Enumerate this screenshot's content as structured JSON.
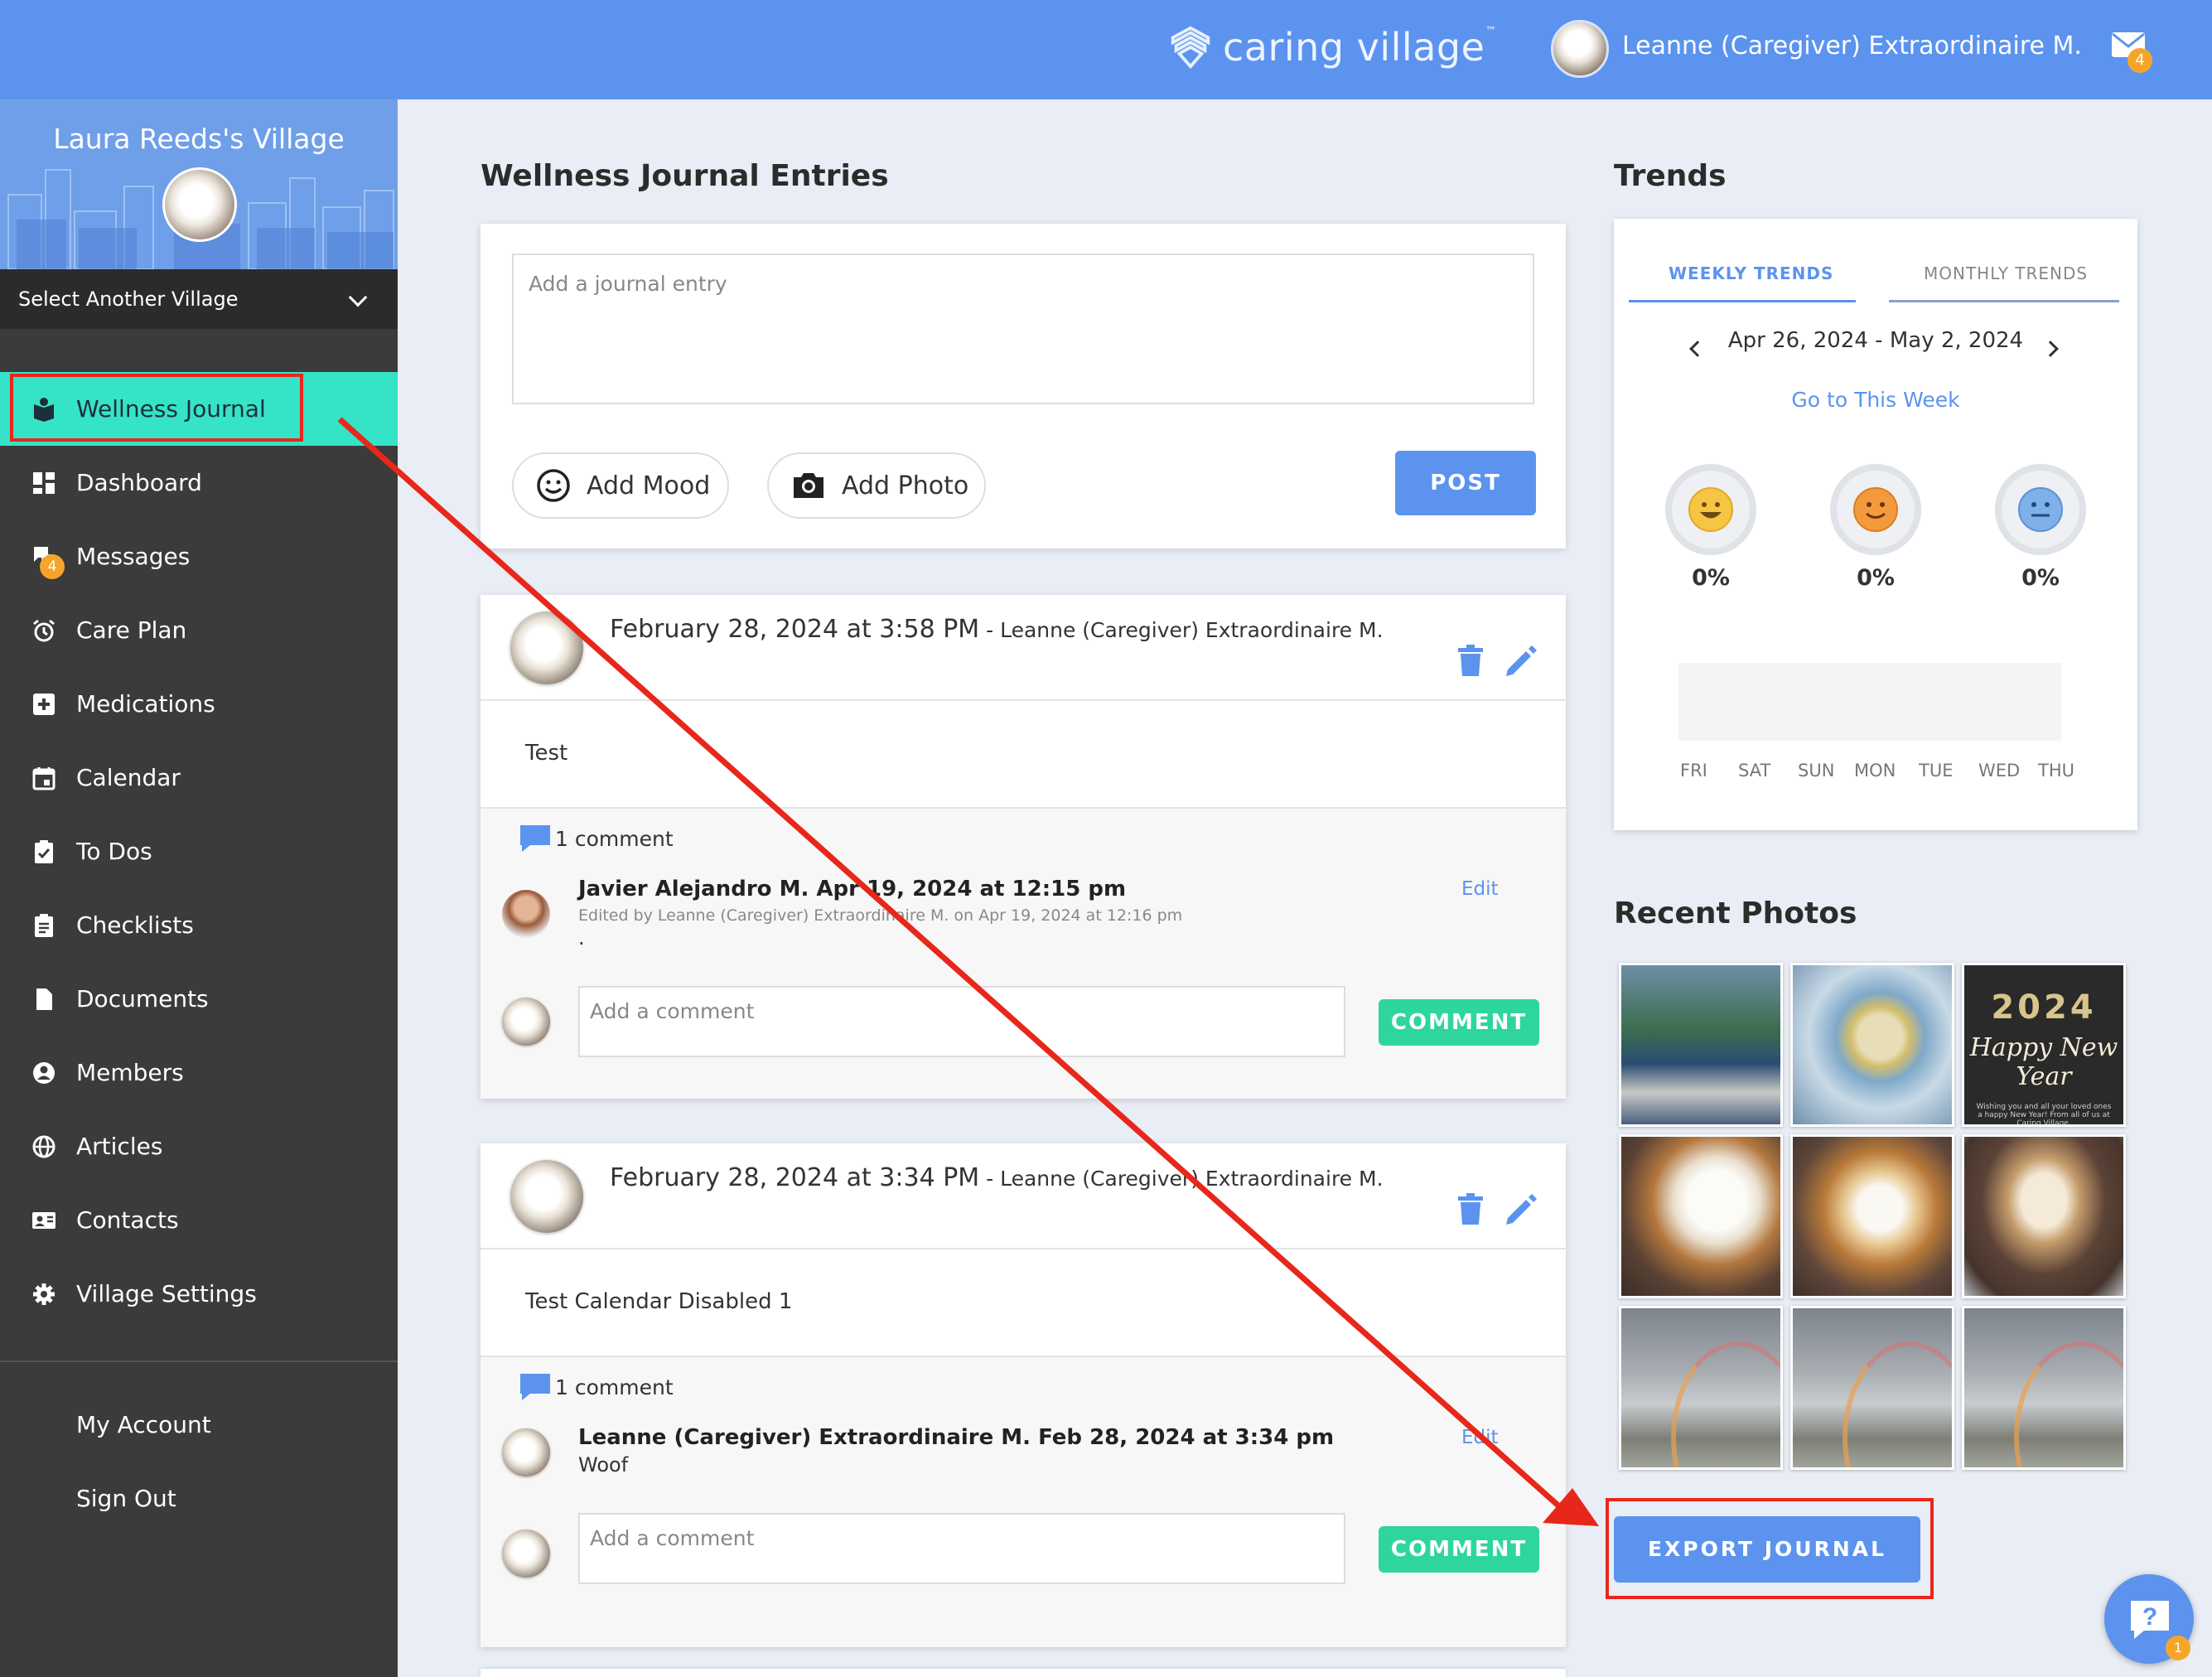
{
  "header": {
    "logo_text": "caring village",
    "logo_tm": "™",
    "user_name": "Leanne (Caregiver) Extraordinaire M.",
    "mail_badge": "4"
  },
  "sidebar": {
    "village_name": "Laura Reeds's Village",
    "select_village": "Select Another Village",
    "items": [
      {
        "label": "Wellness Journal",
        "icon": "journal-icon"
      },
      {
        "label": "Dashboard",
        "icon": "dashboard-icon"
      },
      {
        "label": "Messages",
        "icon": "messages-icon",
        "badge": "4"
      },
      {
        "label": "Care Plan",
        "icon": "alarm-clock-icon"
      },
      {
        "label": "Medications",
        "icon": "medical-cross-icon"
      },
      {
        "label": "Calendar",
        "icon": "calendar-icon"
      },
      {
        "label": "To Dos",
        "icon": "checked-clipboard-icon"
      },
      {
        "label": "Checklists",
        "icon": "clipboard-list-icon"
      },
      {
        "label": "Documents",
        "icon": "document-icon"
      },
      {
        "label": "Members",
        "icon": "person-circle-icon"
      },
      {
        "label": "Articles",
        "icon": "globe-icon"
      },
      {
        "label": "Contacts",
        "icon": "contact-card-icon"
      },
      {
        "label": "Village Settings",
        "icon": "gear-icon"
      }
    ],
    "my_account": "My Account",
    "sign_out": "Sign Out"
  },
  "main": {
    "title": "Wellness Journal Entries",
    "compose": {
      "placeholder": "Add a journal entry",
      "add_mood": "Add Mood",
      "add_photo": "Add Photo",
      "post": "POST"
    },
    "entries": [
      {
        "date": "February 28, 2024 at 3:58 PM",
        "author": " - Leanne (Caregiver) Extraordinaire M.",
        "text": "Test",
        "comment_count": "1 comment",
        "comment": {
          "header": "Javier Alejandro M. Apr 19, 2024 at 12:15 pm",
          "edited": "Edited by Leanne (Caregiver) Extraordinaire M. on Apr 19, 2024 at 12:16 pm",
          "body": ".",
          "edit": "Edit"
        },
        "comment_placeholder": "Add a comment",
        "comment_button": "COMMENT"
      },
      {
        "date": "February 28, 2024 at 3:34 PM",
        "author": " - Leanne (Caregiver) Extraordinaire M.",
        "text": "Test Calendar Disabled 1",
        "comment_count": "1 comment",
        "comment": {
          "header": "Leanne (Caregiver) Extraordinaire M. Feb 28, 2024 at 3:34 pm",
          "body": "Woof",
          "edit": "Edit"
        },
        "comment_placeholder": "Add a comment",
        "comment_button": "COMMENT"
      }
    ]
  },
  "trends": {
    "title": "Trends",
    "tab_weekly": "WEEKLY TRENDS",
    "tab_monthly": "MONTHLY TRENDS",
    "range": "Apr 26, 2024 - May 2, 2024",
    "go_week": "Go to This Week",
    "moods": [
      {
        "name": "happy",
        "color": "#f6c544",
        "pct": "0%"
      },
      {
        "name": "okay",
        "color": "#f39a3c",
        "pct": "0%"
      },
      {
        "name": "neutral",
        "color": "#7fb0ea",
        "pct": "0%"
      }
    ],
    "days": [
      "FRI",
      "SAT",
      "SUN",
      "MON",
      "TUE",
      "WED",
      "THU"
    ]
  },
  "photos": {
    "title": "Recent Photos",
    "new_year": {
      "year": "2024",
      "text": "Happy New Year",
      "small": "Wishing you and all your loved ones a happy New Year! From all of us at Caring Village."
    }
  },
  "export_button": "EXPORT JOURNAL",
  "help_badge": "1",
  "colors": {
    "brand_blue": "#5b93ee",
    "active_teal": "#35e3c7",
    "comment_green": "#2fd59f",
    "badge_orange": "#f5a62a",
    "annotation_red": "#e8271b"
  }
}
